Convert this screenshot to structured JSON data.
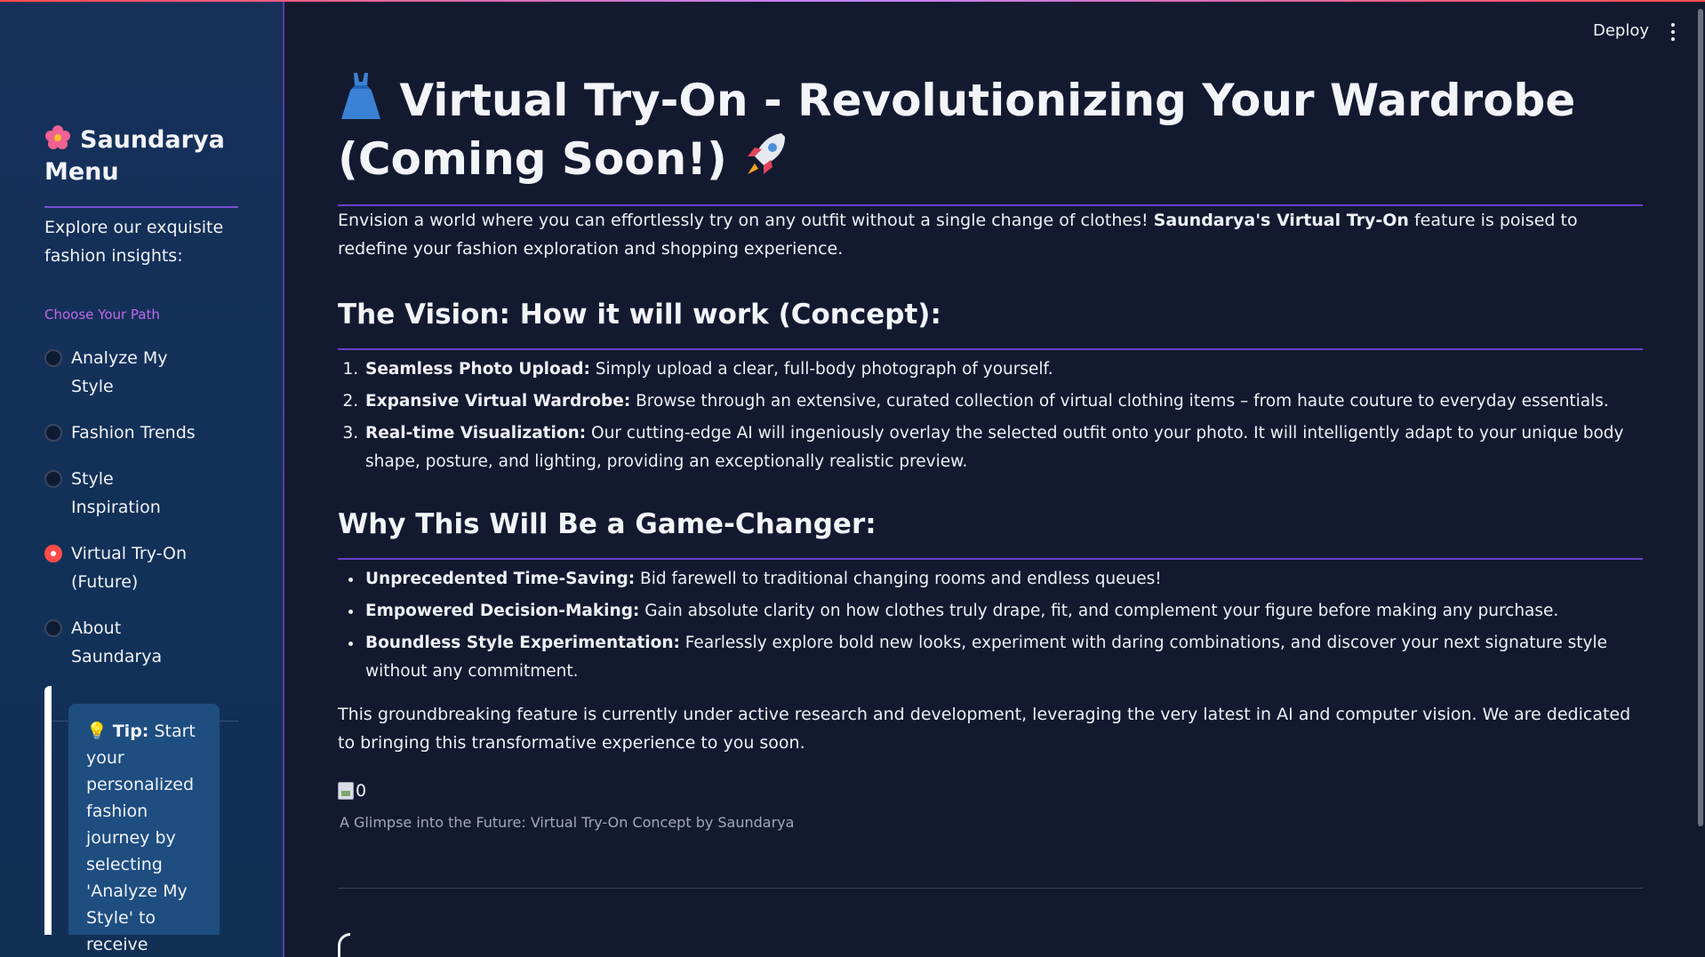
{
  "sidebar": {
    "title": "Saundarya Menu",
    "explore": "Explore our exquisite fashion insights:",
    "path_label": "Choose Your Path",
    "options": [
      {
        "label": "Analyze My Style",
        "selected": false
      },
      {
        "label": "Fashion Trends",
        "selected": false
      },
      {
        "label": "Style Inspiration",
        "selected": false
      },
      {
        "label": "Virtual Try-On (Future)",
        "selected": true
      },
      {
        "label": "About Saundarya",
        "selected": false
      }
    ],
    "tip_bold": "Tip:",
    "tip_text": "Start your personalized fashion journey by selecting 'Analyze My Style' to receive instant"
  },
  "header": {
    "deploy_label": "Deploy"
  },
  "main": {
    "title": "Virtual Try-On - Revolutionizing Your Wardrobe (Coming Soon!)",
    "intro_pre": "Envision a world where you can effortlessly try on any outfit without a single change of clothes! ",
    "intro_bold": "Saundarya's Virtual Try-On",
    "intro_post": " feature is poised to redefine your fashion exploration and shopping experience.",
    "vision_heading": "The Vision: How it will work (Concept):",
    "vision_items": [
      {
        "bold": "Seamless Photo Upload:",
        "text": " Simply upload a clear, full-body photograph of yourself."
      },
      {
        "bold": "Expansive Virtual Wardrobe:",
        "text": " Browse through an extensive, curated collection of virtual clothing items – from haute couture to everyday essentials."
      },
      {
        "bold": "Real-time Visualization:",
        "text": " Our cutting-edge AI will ingeniously overlay the selected outfit onto your photo. It will intelligently adapt to your unique body shape, posture, and lighting, providing an exceptionally realistic preview."
      }
    ],
    "why_heading": "Why This Will Be a Game-Changer:",
    "why_items": [
      {
        "bold": "Unprecedented Time-Saving:",
        "text": " Bid farewell to traditional changing rooms and endless queues!"
      },
      {
        "bold": "Empowered Decision-Making:",
        "text": " Gain absolute clarity on how clothes truly drape, fit, and complement your figure before making any purchase."
      },
      {
        "bold": "Boundless Style Experimentation:",
        "text": " Fearlessly explore bold new looks, experiment with daring combinations, and discover your next signature style without any commitment."
      }
    ],
    "closing": "This groundbreaking feature is currently under active research and development, leveraging the very latest in AI and computer vision. We are dedicated to bringing this transformative experience to you soon.",
    "image_alt": "0",
    "caption": "A Glimpse into the Future: Virtual Try-On Concept by Saundarya"
  },
  "colors": {
    "accent": "#ff4b4b",
    "rule": "#6b3fc9",
    "sidebar_bg": "#16305a",
    "main_bg": "#131a30",
    "path_label": "#c06ae8"
  }
}
